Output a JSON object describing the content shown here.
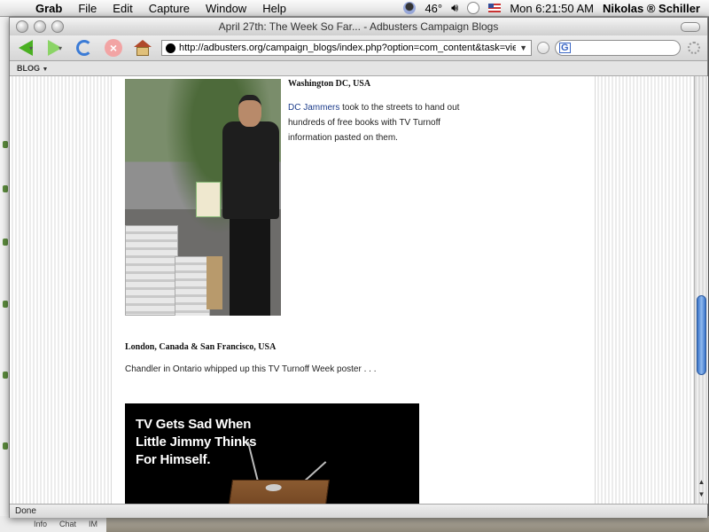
{
  "menubar": {
    "app_name": "Grab",
    "items": [
      "File",
      "Edit",
      "Capture",
      "Window",
      "Help"
    ],
    "temperature": "46°",
    "clock": "Mon 6:21:50 AM",
    "username": "Nikolas ® Schiller"
  },
  "window": {
    "title": "April 27th: The Week So Far... - Adbusters Campaign Blogs",
    "url": "http://adbusters.org/campaign_blogs/index.php?option=com_content&task=view&id",
    "bookmark_label": "BLOG",
    "status": "Done"
  },
  "article": {
    "dc_heading": "Washington DC, USA",
    "dc_text_highlight": "DC Jammers",
    "dc_text_rest": " took to the streets to hand out hundreds of free books with TV Turnoff information pasted on them.",
    "london_heading": "London, Canada & San Francisco, USA",
    "london_text": "Chandler in Ontario whipped up this TV Turnoff Week poster . . .",
    "poster_lines": [
      "TV Gets Sad When",
      "Little Jimmy Thinks",
      "For Himself."
    ]
  },
  "background_window": {
    "bottom_tabs": [
      "Info",
      "Chat",
      "IM"
    ]
  },
  "icons": {
    "back": "back-arrow-icon",
    "forward": "forward-arrow-icon",
    "reload": "reload-icon",
    "stop": "stop-icon",
    "home": "home-icon"
  },
  "colors": {
    "link": "#1b3b8a",
    "scroll_thumb": "#3a74c9"
  }
}
